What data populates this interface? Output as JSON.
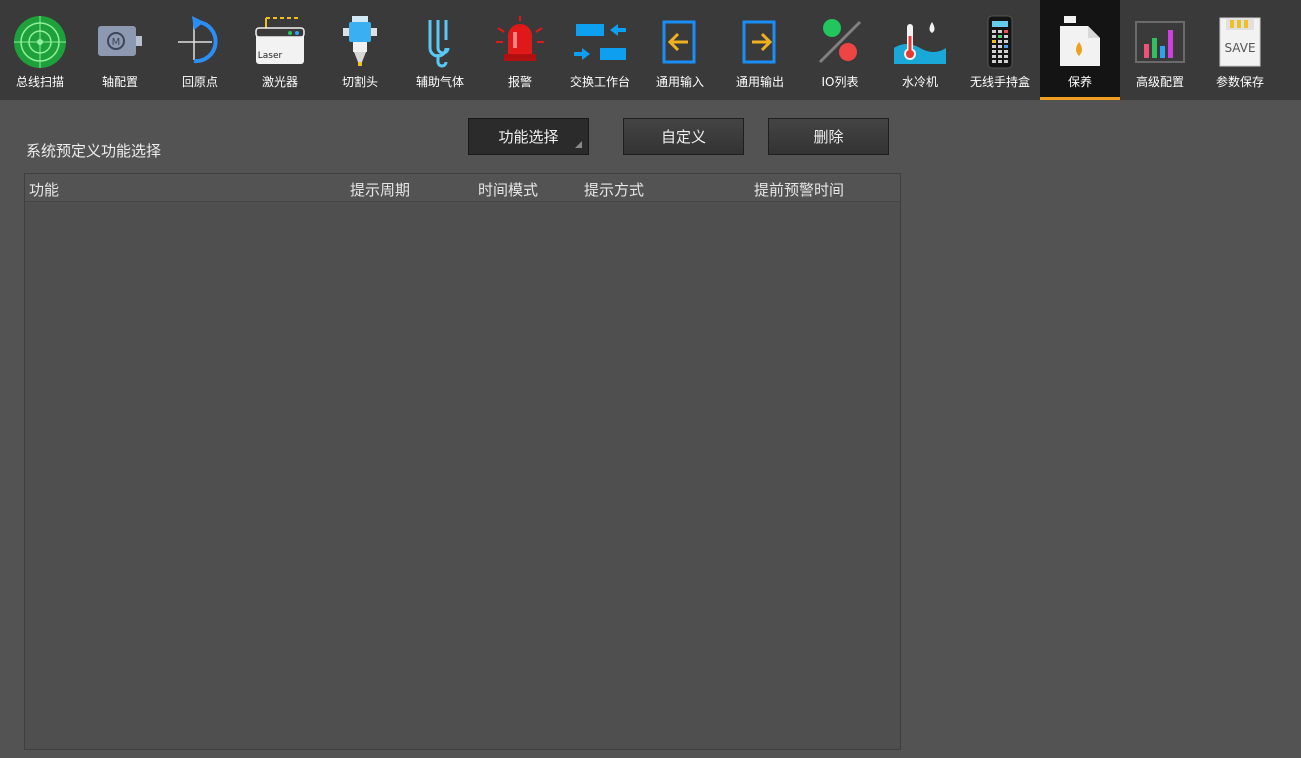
{
  "toolbar": {
    "items": [
      {
        "id": "bus-scan",
        "label": "总线扫描",
        "icon": "radar-icon"
      },
      {
        "id": "axis-config",
        "label": "轴配置",
        "icon": "motor-icon"
      },
      {
        "id": "homing",
        "label": "回原点",
        "icon": "home-return-icon"
      },
      {
        "id": "laser",
        "label": "激光器",
        "icon": "laser-icon"
      },
      {
        "id": "cutting-head",
        "label": "切割头",
        "icon": "cutting-head-icon"
      },
      {
        "id": "assist-gas",
        "label": "辅助气体",
        "icon": "gas-icon"
      },
      {
        "id": "alarm",
        "label": "报警",
        "icon": "alarm-light-icon"
      },
      {
        "id": "exchange-table",
        "label": "交换工作台",
        "icon": "exchange-icon"
      },
      {
        "id": "general-input",
        "label": "通用输入",
        "icon": "input-icon"
      },
      {
        "id": "general-output",
        "label": "通用输出",
        "icon": "output-icon"
      },
      {
        "id": "io-list",
        "label": "IO列表",
        "icon": "io-toggle-icon"
      },
      {
        "id": "water-chiller",
        "label": "水冷机",
        "icon": "thermometer-icon"
      },
      {
        "id": "wireless-handheld",
        "label": "无线手持盒",
        "icon": "remote-icon"
      },
      {
        "id": "maintenance",
        "label": "保养",
        "icon": "oil-can-icon",
        "active": true
      },
      {
        "id": "advanced-config",
        "label": "高级配置",
        "icon": "bar-chart-icon"
      },
      {
        "id": "param-save",
        "label": "参数保存",
        "icon": "save-card-icon"
      }
    ]
  },
  "main": {
    "section_title": "系统预定义功能选择",
    "buttons": {
      "function_select": "功能选择",
      "custom": "自定义",
      "delete": "删除"
    },
    "table": {
      "columns": [
        "功能",
        "提示周期",
        "时间模式",
        "提示方式",
        "提前预警时间"
      ],
      "rows": []
    },
    "save_icon_text": "SAVE",
    "laser_icon_text": "Laser"
  },
  "colors": {
    "toolbar_bg": "#3a3a3a",
    "active_bg": "#141414",
    "active_accent": "#f0a020",
    "content_bg": "#535353",
    "table_bg": "#4f4f4f"
  }
}
